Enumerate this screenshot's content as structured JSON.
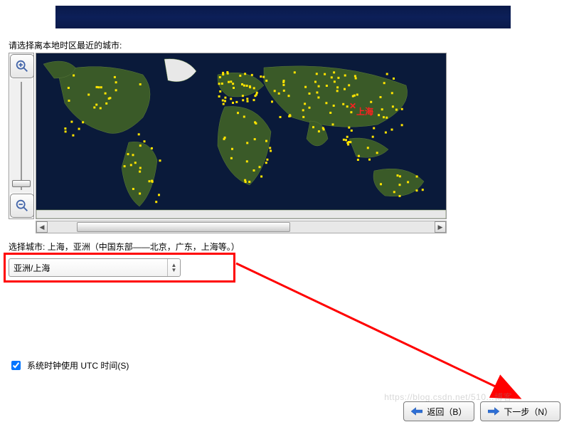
{
  "banner": {
    "title": ""
  },
  "instruction": "请选择离本地时区最近的城市:",
  "map": {
    "selected_city_marker_label": "上海",
    "zoom_in_icon": "zoom-in",
    "zoom_out_icon": "zoom-out"
  },
  "city_row": {
    "prefix": "选择城市:",
    "value": "上海，亚洲（中国东部——北京，广东，上海等。）"
  },
  "timezone_select": {
    "value": "亚洲/上海"
  },
  "utc_checkbox": {
    "label": "系统时钟使用 UTC 时间(S)",
    "checked": true
  },
  "nav": {
    "back_label": "返回（B）",
    "next_label": "下一步（N）"
  },
  "watermark": "https://blog.csdn.net/510...博客",
  "colors": {
    "highlight": "#ff0000",
    "banner": "#0c1f58",
    "ocean": "#0a1a3a",
    "land": "#2f4d1e",
    "dot": "#ffe400",
    "arrow": "#2e6fd6"
  }
}
